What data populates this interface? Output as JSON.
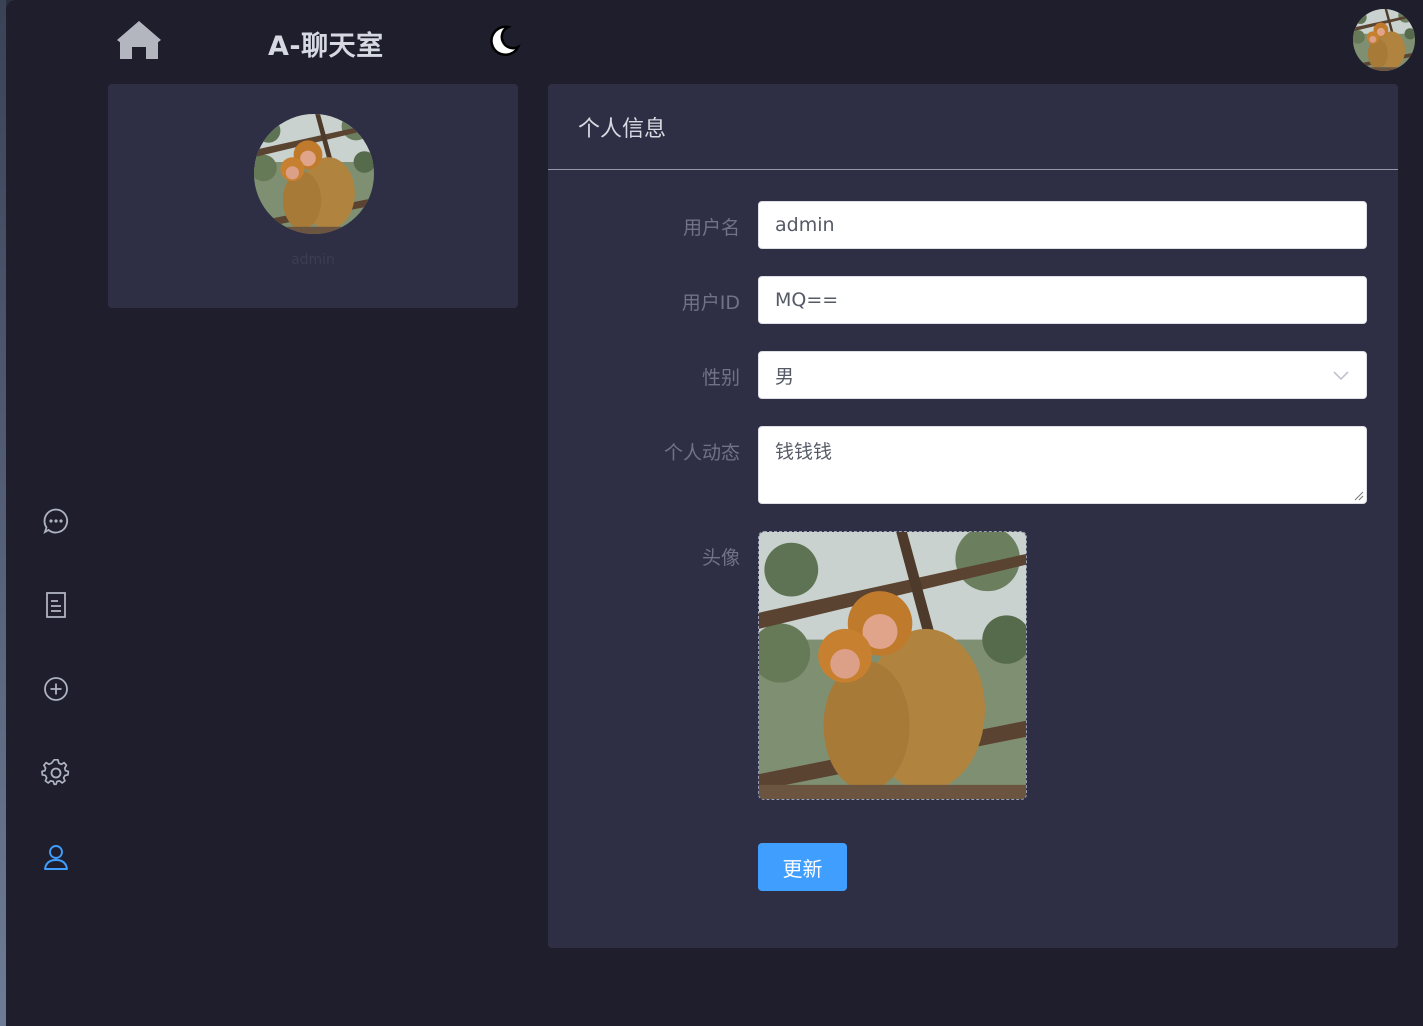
{
  "header": {
    "home_icon": "home-icon",
    "app_title": "A-聊天室",
    "theme_icon": "moon-icon",
    "user_avatar": "user-avatar"
  },
  "sidebar": {
    "items": [
      {
        "icon": "chat-icon",
        "active": false
      },
      {
        "icon": "document-icon",
        "active": false
      },
      {
        "icon": "add-circle-icon",
        "active": false
      },
      {
        "icon": "gear-icon",
        "active": false
      },
      {
        "icon": "user-icon",
        "active": true
      }
    ],
    "active_color": "#409eff",
    "icon_color": "#aeb3c2"
  },
  "profile_card": {
    "avatar": "monkey-avatar",
    "name": "admin"
  },
  "info": {
    "title": "个人信息",
    "username_label": "用户名",
    "username_value": "admin",
    "userid_label": "用户ID",
    "userid_value": "MQ==",
    "gender_label": "性别",
    "gender_value": "男",
    "status_label": "个人动态",
    "status_value": "钱钱钱",
    "avatar_label": "头像",
    "update_button": "更新"
  },
  "colors": {
    "background": "#1f1e2c",
    "card": "#2e2f44",
    "primary": "#409eff"
  }
}
